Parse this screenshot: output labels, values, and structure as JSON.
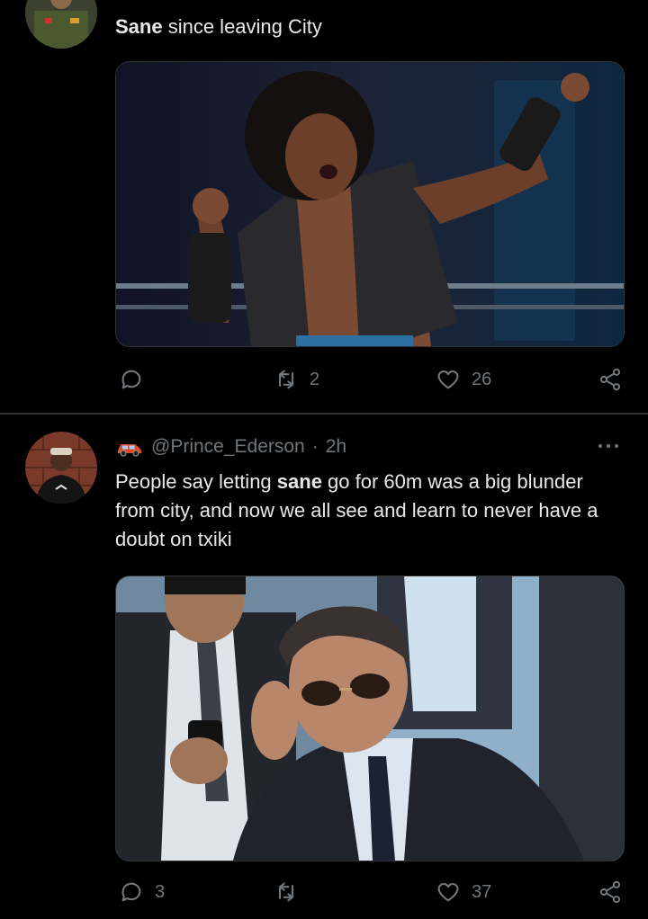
{
  "tweets": [
    {
      "text_bold": "Sane",
      "text_rest": " since leaving City",
      "actions": {
        "reply_count": "",
        "retweet_count": "2",
        "like_count": "26"
      }
    },
    {
      "handle": "@Prince_Ederson",
      "separator": "·",
      "time": "2h",
      "text_before": "People say letting ",
      "text_bold": "sane",
      "text_after": " go for 60m was a big blunder from city, and now we all see and learn to never have a doubt on txiki",
      "actions": {
        "reply_count": "3",
        "retweet_count": "",
        "like_count": "37"
      }
    }
  ],
  "icons": [
    "reply-icon",
    "retweet-icon",
    "like-icon",
    "share-icon",
    "more-icon",
    "car-emoji-icon"
  ],
  "colors": {
    "background": "#000000",
    "text": "#e7e9ea",
    "muted": "#71767b",
    "divider": "#2f3336"
  }
}
